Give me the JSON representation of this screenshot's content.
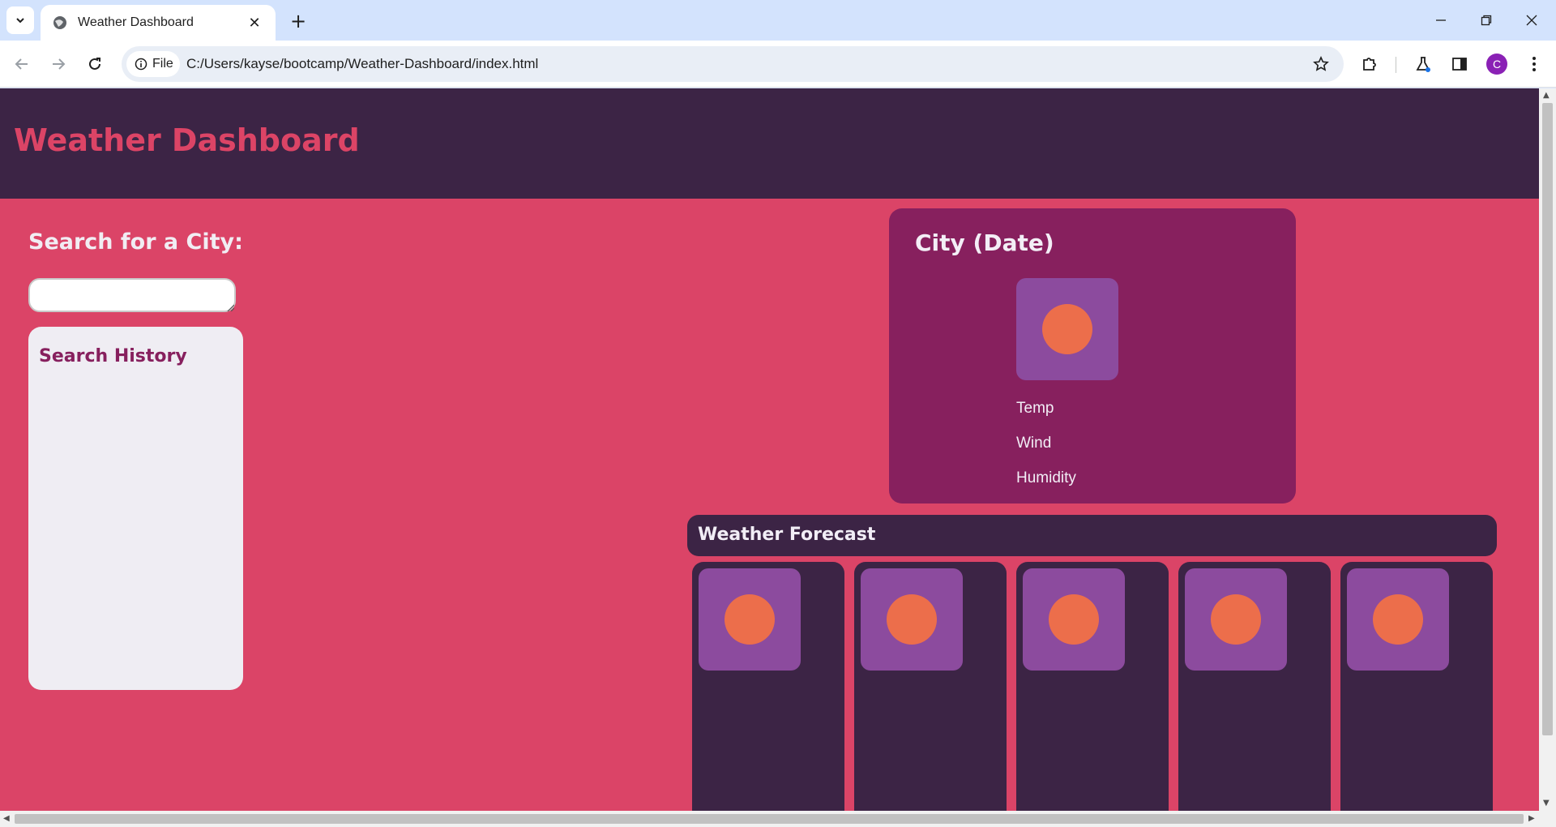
{
  "browser": {
    "tab_title": "Weather Dashboard",
    "chip_label": "File",
    "url": "C:/Users/kayse/bootcamp/Weather-Dashboard/index.html",
    "profile_initial": "C"
  },
  "header": {
    "title": "Weather Dashboard"
  },
  "search": {
    "heading": "Search for a City:",
    "input_value": "",
    "history_title": "Search History"
  },
  "current": {
    "title": "City (Date)",
    "icon": "sun-icon",
    "metrics": [
      "Temp",
      "Wind",
      "Humidity"
    ]
  },
  "forecast": {
    "title": "Weather Forecast",
    "cards": [
      {
        "icon": "sun-icon"
      },
      {
        "icon": "sun-icon"
      },
      {
        "icon": "sun-icon"
      },
      {
        "icon": "sun-icon"
      },
      {
        "icon": "sun-icon"
      }
    ]
  },
  "colors": {
    "header_bg": "#3c2445",
    "page_bg": "#db4467",
    "card_bg": "#87205e",
    "icon_box": "#8c4b9e",
    "sun": "#ec6e4b"
  }
}
